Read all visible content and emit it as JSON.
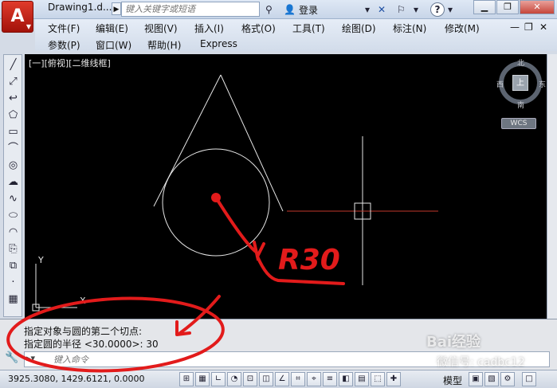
{
  "titlebar": {
    "doc_title": "Drawing1.d...",
    "search_placeholder": "键入关键字或短语",
    "login_label": "登录",
    "help_label": "?",
    "app_letter": "A"
  },
  "menu": {
    "row1": [
      "文件(F)",
      "编辑(E)",
      "视图(V)",
      "插入(I)",
      "格式(O)",
      "工具(T)",
      "绘图(D)",
      "标注(N)",
      "修改(M)"
    ],
    "row2": [
      "参数(P)",
      "窗口(W)",
      "帮助(H)",
      "Express"
    ]
  },
  "viewport": {
    "label": "[一][俯视][二维线框]",
    "compass": {
      "north": "北",
      "south": "南",
      "west": "西",
      "east": "东",
      "top": "上"
    },
    "wcs": "WCS",
    "annotation": "R30"
  },
  "command": {
    "line1": "指定对象与圆的第二个切点:",
    "line2": "指定圆的半径 <30.0000>: 30",
    "input_placeholder": "键入命令"
  },
  "status": {
    "coords": "3925.3080,  1429.6121,  0.0000",
    "model": "模型"
  },
  "watermark": {
    "brand": "Bai经验",
    "sub": "微信号: cadbc12"
  },
  "colors": {
    "canvas": "#000000",
    "annotation_red": "#e21b1b",
    "crosshair_red": "#c0392b"
  }
}
